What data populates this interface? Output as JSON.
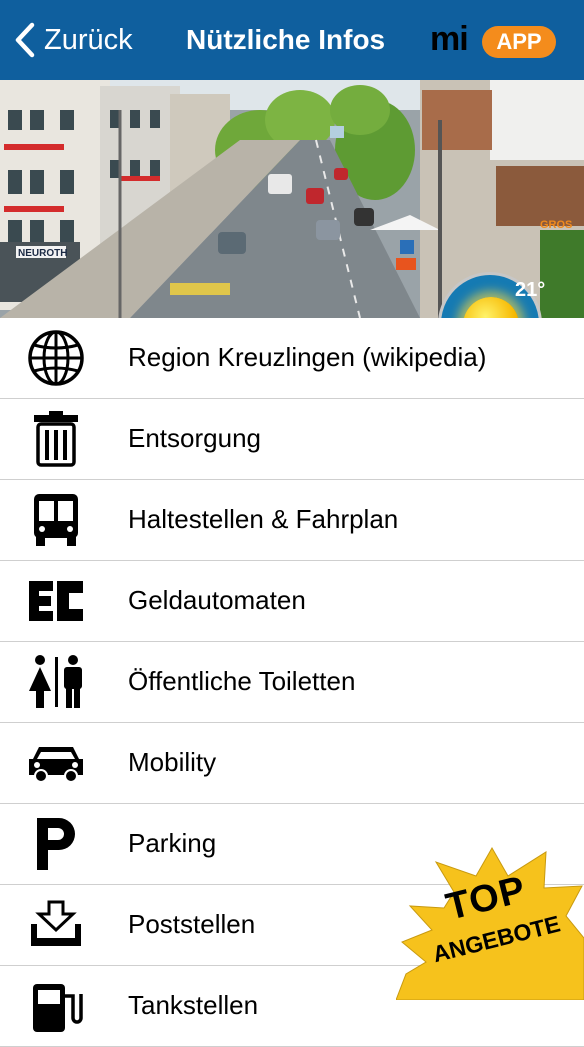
{
  "nav": {
    "back_label": "Zurück",
    "title": "Nützliche Infos",
    "logo_mi": "mi",
    "logo_app": "APP"
  },
  "hero": {
    "temperature": "21°",
    "storefront_sign": "NEUROTH",
    "store_sign": "GROS"
  },
  "menu": [
    {
      "label": "Region Kreuzlingen (wikipedia)",
      "icon": "globe-icon"
    },
    {
      "label": "Entsorgung",
      "icon": "trash-bin-icon"
    },
    {
      "label": "Haltestellen & Fahrplan",
      "icon": "bus-icon"
    },
    {
      "label": "Geldautomaten",
      "icon": "ec-card-icon"
    },
    {
      "label": "Öffentliche Toiletten",
      "icon": "restroom-icon"
    },
    {
      "label": "Mobility",
      "icon": "car-icon"
    },
    {
      "label": "Parking",
      "icon": "parking-icon"
    },
    {
      "label": "Poststellen",
      "icon": "inbox-download-icon"
    },
    {
      "label": "Tankstellen",
      "icon": "fuel-pump-icon"
    }
  ],
  "badge": {
    "line1": "TOP",
    "line2": "ANGEBOTE"
  },
  "colors": {
    "navbar": "#0f5f9e",
    "logo_accent": "#f48c1c",
    "badge": "#f6c21c"
  }
}
